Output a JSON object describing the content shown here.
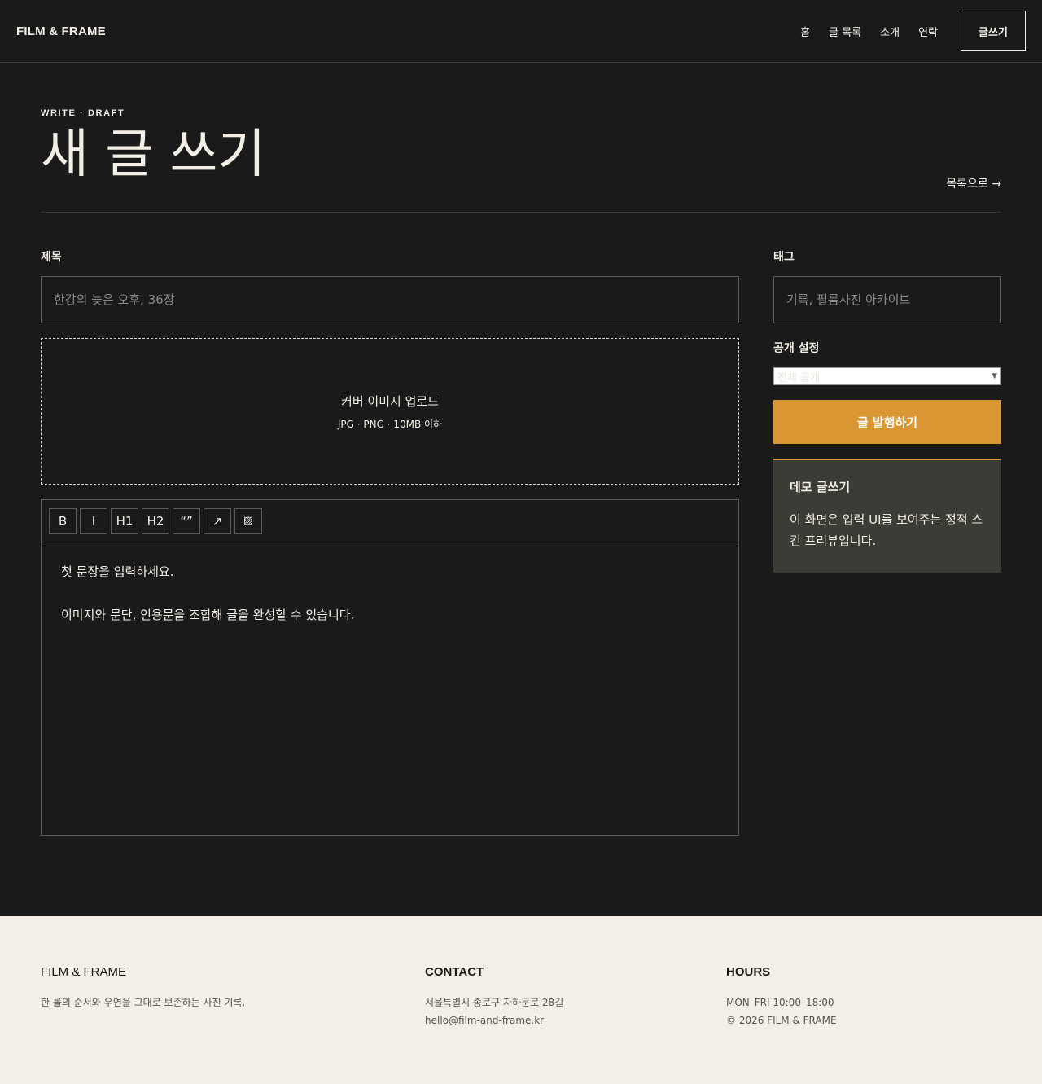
{
  "header": {
    "brand": "FILM & FRAME",
    "nav": [
      "홈",
      "글 목록",
      "소개",
      "연락"
    ],
    "write_button": "글쓰기"
  },
  "page": {
    "kicker": "WRITE · DRAFT",
    "title": "새 글 쓰기",
    "back_link": "목록으로 →"
  },
  "form": {
    "title_label": "제목",
    "title_placeholder": "한강의 늦은 오후, 36장",
    "upload_title": "커버 이미지 업로드",
    "upload_sub": "JPG · PNG · 10MB 이하",
    "toolbar": [
      {
        "label": "B",
        "icon": "bold-icon"
      },
      {
        "label": "I",
        "icon": "italic-icon"
      },
      {
        "label": "H1",
        "icon": "heading1-icon"
      },
      {
        "label": "H2",
        "icon": "heading2-icon"
      },
      {
        "label": "“”",
        "icon": "quote-icon"
      },
      {
        "label": "↗",
        "icon": "link-icon"
      },
      {
        "label": "▨",
        "icon": "image-icon"
      }
    ],
    "editor_paragraphs": [
      "첫 문장을 입력하세요.",
      "이미지와 문단, 인용문을 조합해 글을 완성할 수 있습니다."
    ]
  },
  "sidebar": {
    "tags_label": "태그",
    "tags_placeholder": "기록, 필름사진 아카이브",
    "visibility_label": "공개 설정",
    "visibility_value": "전체 공개",
    "publish_button": "글 발행하기",
    "demo_title": "데모 글쓰기",
    "demo_text": "이 화면은 입력 UI를 보여주는 정적 스킨 프리뷰입니다."
  },
  "footer": {
    "col1_title": "FILM & FRAME",
    "col1_text": "한 롤의 순서와 우연을 그대로 보존하는 사진 기록.",
    "col2_title": "CONTACT",
    "col2_lines": [
      "서울특별시 종로구 자하문로 28길",
      "hello@film-and-frame.kr"
    ],
    "col3_title": "HOURS",
    "col3_lines": [
      "MON–FRI 10:00–18:00",
      "© 2026 FILM & FRAME"
    ]
  },
  "colors": {
    "background": "#1a1a1a",
    "accent": "#d99632",
    "footer_bg": "#f4efe6"
  }
}
